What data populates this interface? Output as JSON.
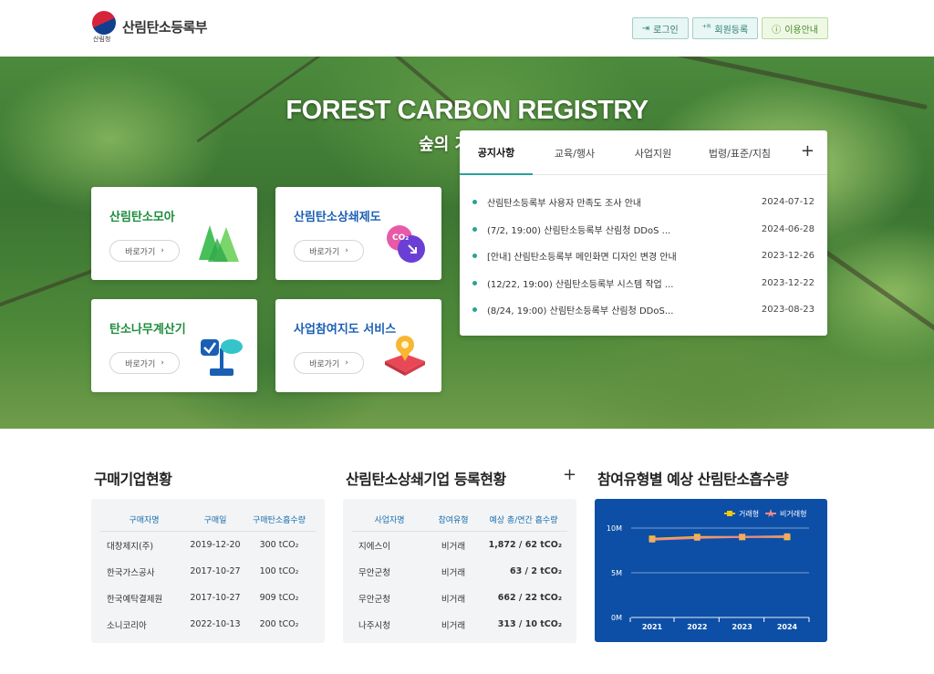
{
  "header": {
    "logo_sub": "산림청",
    "logo_name": "산림탄소등록부",
    "buttons": [
      {
        "icon": "login-icon",
        "label": "로그인"
      },
      {
        "icon": "user-add-icon",
        "label": "회원등록"
      },
      {
        "icon": "info-icon",
        "label": "이용안내"
      }
    ]
  },
  "hero": {
    "title": "FOREST CARBON REGISTRY",
    "subtitle": "숲의 가치창조"
  },
  "quick_cards": [
    {
      "title": "산림탄소모아",
      "button": "바로가기",
      "icon": "tree-icon"
    },
    {
      "title": "산림탄소상쇄제도",
      "button": "바로가기",
      "icon": "co2-icon"
    },
    {
      "title": "탄소나무계산기",
      "button": "바로가기",
      "icon": "sprout-check-icon"
    },
    {
      "title": "사업참여지도 서비스",
      "button": "바로가기",
      "icon": "map-pin-icon"
    }
  ],
  "notice": {
    "tabs": [
      "공지사항",
      "교육/행사",
      "사업지원",
      "법령/표준/지침"
    ],
    "plus": "+",
    "items": [
      {
        "title": "산림탄소등록부 사용자 만족도 조사 안내",
        "date": "2024-07-12"
      },
      {
        "title": "(7/2, 19:00) 산림탄소등록부 산림청 DDoS ...",
        "date": "2024-06-28"
      },
      {
        "title": "[안내] 산림탄소등록부 메인화면 디자인 변경 안내",
        "date": "2023-12-26"
      },
      {
        "title": "(12/22, 19:00) 산림탄소등록부 시스템 작업 ...",
        "date": "2023-12-22"
      },
      {
        "title": "(8/24, 19:00) 산림탄소등록부 산림청 DDoS...",
        "date": "2023-08-23"
      }
    ]
  },
  "buyers": {
    "title": "구매기업현황",
    "columns": [
      "구매자명",
      "구매일",
      "구매탄소흡수량"
    ],
    "rows": [
      [
        "대창제지(주)",
        "2019-12-20",
        "300 tCO₂"
      ],
      [
        "한국가스공사",
        "2017-10-27",
        "100 tCO₂"
      ],
      [
        "한국예탁결제원",
        "2017-10-27",
        "909 tCO₂"
      ],
      [
        "소니코리아",
        "2022-10-13",
        "200 tCO₂"
      ]
    ]
  },
  "offset_registry": {
    "title": "산림탄소상쇄기업 등록현황",
    "plus": "+",
    "columns": [
      "사업자명",
      "참여유형",
      "예상 총/연간 흡수량"
    ],
    "rows": [
      [
        "지에스이",
        "비거래",
        "1,872 / 62 tCO₂"
      ],
      [
        "무안군청",
        "비거래",
        "63 / 2 tCO₂"
      ],
      [
        "무안군청",
        "비거래",
        "662 / 22 tCO₂"
      ],
      [
        "나주시청",
        "비거래",
        "313 / 10 tCO₂"
      ]
    ]
  },
  "absorption": {
    "title": "참여유형별 예상 산림탄소흡수량"
  },
  "chart_data": {
    "type": "line",
    "title": "",
    "xlabel": "",
    "ylabel": "",
    "categories": [
      "2021",
      "2022",
      "2023",
      "2024"
    ],
    "ylim": [
      0,
      10000000
    ],
    "yticks": [
      "0M",
      "5M",
      "10M"
    ],
    "legend_position": "top-right",
    "series": [
      {
        "name": "거래형",
        "values": [
          8800000,
          9000000,
          9000000,
          9000000
        ],
        "color": "#f5c518"
      },
      {
        "name": "비거래형",
        "values": [
          8700000,
          8900000,
          9000000,
          9100000
        ],
        "color": "#f08a8a"
      }
    ]
  }
}
